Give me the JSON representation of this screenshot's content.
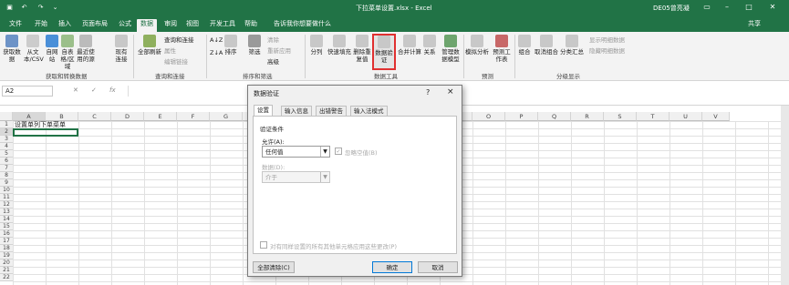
{
  "titlebar": {
    "title": "下拉菜单设置.xlsx - Excel",
    "user": "DE05曾亮凝"
  },
  "tabs": [
    "文件",
    "开始",
    "插入",
    "页面布局",
    "公式",
    "数据",
    "审阅",
    "视图",
    "开发工具",
    "帮助"
  ],
  "tell_me": "告诉我你想要做什么",
  "share": "共享",
  "ribbon": {
    "get_data": "获取数据",
    "from_csv": "从文本/CSV",
    "from_web": "自网站",
    "from_table": "自表格/区域",
    "recent": "最近使用的源",
    "existing": "现有连接",
    "refresh_all": "全部刷新",
    "queries": "查询和连接",
    "properties": "属性",
    "edit_links": "编辑链接",
    "sort": "排序",
    "filter": "筛选",
    "clear": "清除",
    "reapply": "重新应用",
    "advanced": "高级",
    "text_to_cols": "分列",
    "flash_fill": "快速填充",
    "remove_dup": "删除重复值",
    "data_val": "数据验证",
    "consolidate": "合并计算",
    "relationships": "关系",
    "data_model": "管理数据模型",
    "what_if": "模拟分析",
    "forecast": "预测工作表",
    "group": "组合",
    "ungroup": "取消组合",
    "subtotal": "分类汇总",
    "show_detail": "显示明细数据",
    "hide_detail": "隐藏明细数据",
    "groups": {
      "get": "获取和转换数据",
      "query": "查询和连接",
      "sort": "排序和筛选",
      "tools": "数据工具",
      "forecast": "预测",
      "outline": "分级显示"
    }
  },
  "namebox": "A2",
  "columns": [
    "A",
    "B",
    "C",
    "D",
    "E",
    "F",
    "G",
    "H",
    "I",
    "J",
    "K",
    "L",
    "M",
    "N",
    "O",
    "P",
    "Q",
    "R",
    "S",
    "T",
    "U",
    "V"
  ],
  "rows": [
    "1",
    "2",
    "3",
    "4",
    "5",
    "6",
    "7",
    "8",
    "9",
    "10",
    "11",
    "12",
    "13",
    "14",
    "15",
    "16",
    "17",
    "18",
    "19",
    "20",
    "21",
    "22"
  ],
  "cell_a1": "设置单列下单菜单",
  "dialog": {
    "title": "数据验证",
    "help": "?",
    "close": "×",
    "tabs": [
      "设置",
      "输入信息",
      "出错警告",
      "输入法模式"
    ],
    "criteria": "验证条件",
    "allow_label": "允许(A):",
    "allow_value": "任何值",
    "ignore_blank": "忽略空值(B)",
    "data_label": "数据(D):",
    "data_value": "介于",
    "apply_all": "对有同样设置的所有其他单元格应用这些更改(P)",
    "clear_all": "全部清除(C)",
    "ok": "确定",
    "cancel": "取消"
  }
}
